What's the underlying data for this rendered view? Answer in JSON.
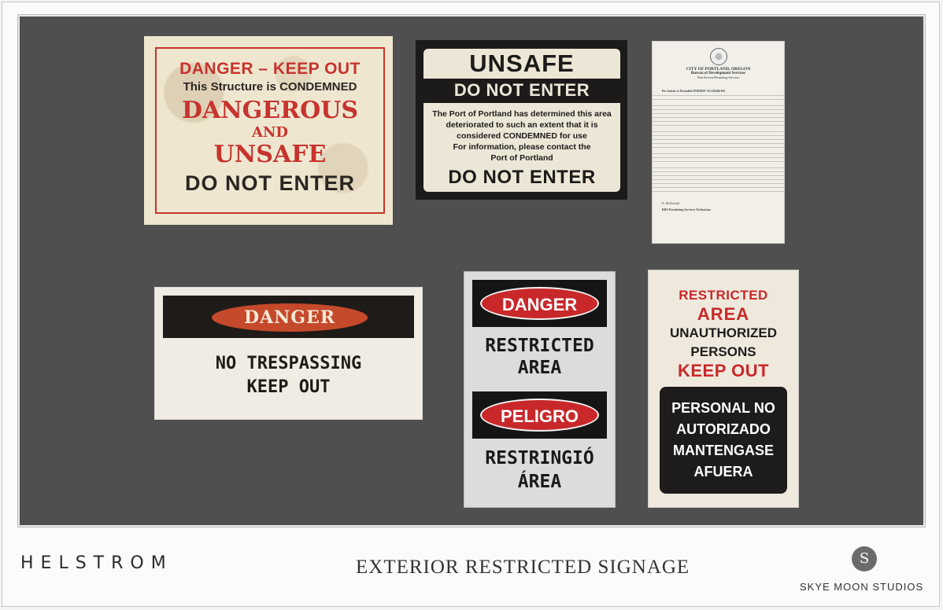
{
  "sign_danger_keep_out": {
    "line1": "DANGER – KEEP OUT",
    "line2": "This Structure is CONDEMNED",
    "line3": "DANGEROUS",
    "line4": "AND",
    "line5": "UNSAFE",
    "line6": "DO NOT ENTER"
  },
  "sign_unsafe": {
    "title": "UNSAFE",
    "subtitle": "DO NOT ENTER",
    "body1": "The Port of Portland has determined this area",
    "body2": "deteriorated to such an extent that it is",
    "body3": "considered CONDEMNED for use",
    "body4": "For information, please contact the",
    "body5": "Port of Portland",
    "footer": "DO NOT ENTER"
  },
  "sign_letter": {
    "header1": "CITY OF PORTLAND, OREGON",
    "header2": "Bureau of Development Services",
    "header3": "Plan Review/Permitting Services",
    "re_line": "Re: Intent to Demolish PERMIT 16-226384 RS",
    "signature": "K. McDonald",
    "signature_title": "BDS Permitting Services Technician"
  },
  "sign_no_trespassing": {
    "badge": "DANGER",
    "line1": "NO TRESPASSING",
    "line2": "KEEP OUT"
  },
  "sign_bilingual": {
    "badge_en": "DANGER",
    "text_en1": "RESTRICTED",
    "text_en2": "AREA",
    "badge_es": "PELIGRO",
    "text_es1": "RESTRINGIÓ",
    "text_es2": "ÁREA"
  },
  "sign_restricted_area": {
    "line1": "RESTRICTED",
    "line2": "AREA",
    "line3": "UNAUTHORIZED",
    "line4": "PERSONS",
    "line5": "KEEP OUT",
    "es1": "PERSONAL NO",
    "es2": "AUTORIZADO",
    "es3": "MANTENGASE",
    "es4": "AFUERA"
  },
  "footer": {
    "brand": "HELSTROM",
    "title": "EXTERIOR RESTRICTED SIGNAGE",
    "studio_mark": "S",
    "studio": "SKYE MOON STUDIOS"
  },
  "colors": {
    "board": "#4f4f4f",
    "sign_red": "#c7332d",
    "sign_dark": "#2b2622"
  }
}
